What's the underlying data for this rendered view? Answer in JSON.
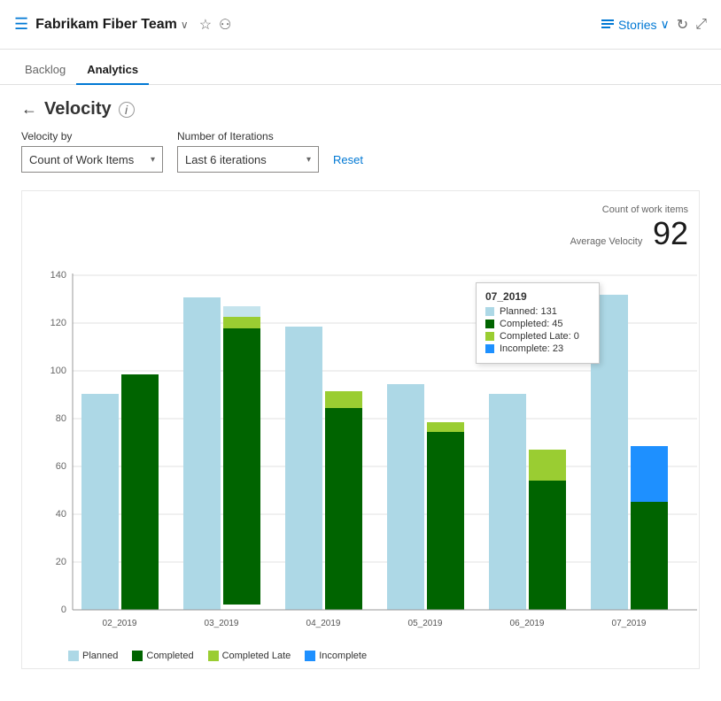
{
  "header": {
    "icon": "☰",
    "team_name": "Fabrikam Fiber Team",
    "chevron": "∨",
    "star": "☆",
    "people": "⚇",
    "stories_label": "Stories",
    "stories_chevron": "∨"
  },
  "nav": {
    "tabs": [
      {
        "label": "Backlog",
        "active": false
      },
      {
        "label": "Analytics",
        "active": true
      }
    ]
  },
  "page": {
    "title": "Velocity",
    "back_arrow": "←",
    "help": "i"
  },
  "filters": {
    "velocity_by_label": "Velocity by",
    "velocity_by_value": "Count of Work Items",
    "iterations_label": "Number of Iterations",
    "iterations_value": "Last 6 iterations",
    "reset_label": "Reset"
  },
  "chart": {
    "meta_label": "Count of work items",
    "meta_sublabel": "Average Velocity",
    "meta_value": "92",
    "y_axis": [
      0,
      20,
      40,
      60,
      80,
      100,
      120,
      140
    ],
    "bars": [
      {
        "label": "02_2019",
        "planned": 90,
        "completed": 98,
        "completed_late": 0,
        "incomplete": 0
      },
      {
        "label": "03_2019",
        "planned": 130,
        "completed": 120,
        "completed_late": 0,
        "incomplete": 0
      },
      {
        "label": "04_2019",
        "planned": 118,
        "completed": 84,
        "completed_late": 7,
        "incomplete": 0
      },
      {
        "label": "05_2019",
        "planned": 94,
        "completed": 74,
        "completed_late": 4,
        "incomplete": 0
      },
      {
        "label": "06_2019",
        "planned": 90,
        "completed": 54,
        "completed_late": 13,
        "incomplete": 0
      },
      {
        "label": "07_2019",
        "planned": 131,
        "completed": 45,
        "completed_late": 0,
        "incomplete": 23
      }
    ],
    "tooltip": {
      "title": "07_2019",
      "rows": [
        {
          "color": "#add8e6",
          "label": "Planned: 131"
        },
        {
          "color": "#006400",
          "label": "Completed: 45"
        },
        {
          "color": "#9acd32",
          "label": "Completed Late: 0"
        },
        {
          "color": "#1e90ff",
          "label": "Incomplete: 23"
        }
      ]
    },
    "legend": [
      {
        "label": "Planned",
        "color": "#add8e6"
      },
      {
        "label": "Completed",
        "color": "#006400"
      },
      {
        "label": "Completed Late",
        "color": "#9acd32"
      },
      {
        "label": "Incomplete",
        "color": "#1e90ff"
      }
    ]
  }
}
